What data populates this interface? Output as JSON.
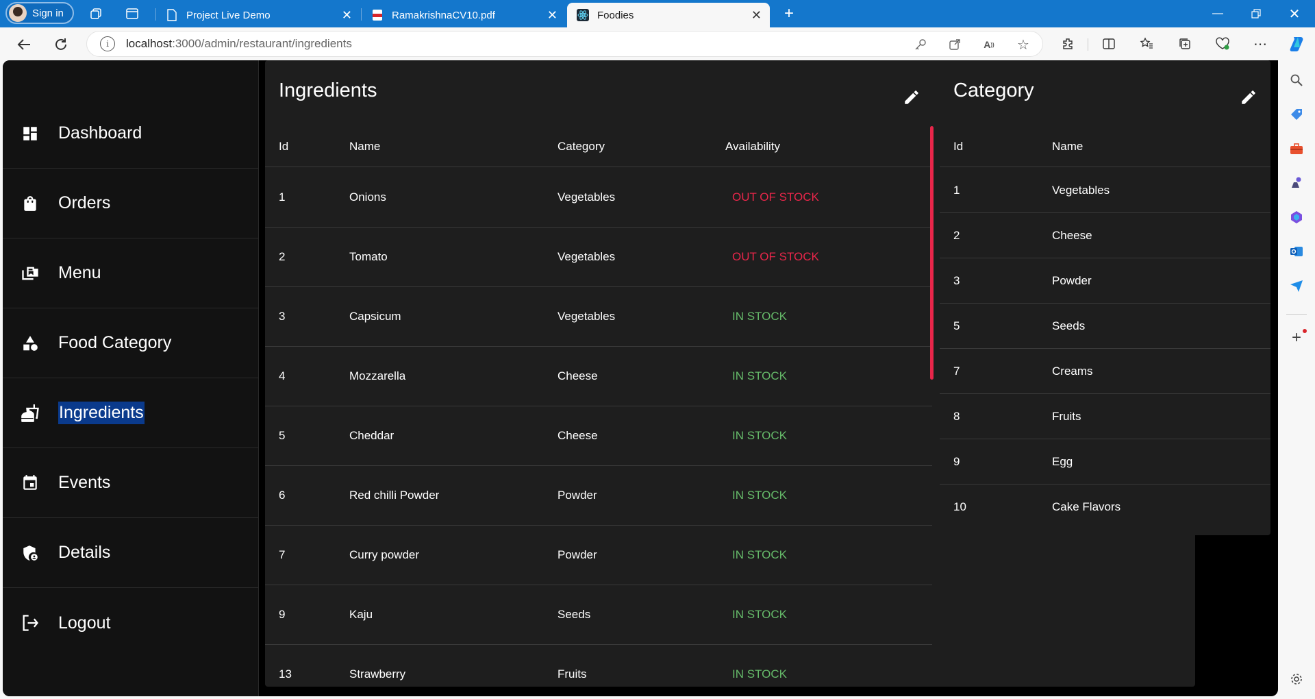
{
  "browser": {
    "sign_in_label": "Sign in",
    "tabs": [
      {
        "title": "Project Live Demo",
        "icon": "page-icon"
      },
      {
        "title": "RamakrishnaCV10.pdf",
        "icon": "pdf-icon"
      },
      {
        "title": "Foodies",
        "icon": "react-icon"
      }
    ],
    "url_host": "localhost",
    "url_path": ":3000/admin/restaurant/ingredients"
  },
  "sidebar": {
    "items": [
      {
        "label": "Dashboard",
        "icon": "dashboard-icon"
      },
      {
        "label": "Orders",
        "icon": "shopping-bag-icon"
      },
      {
        "label": "Menu",
        "icon": "menu-book-icon"
      },
      {
        "label": "Food Category",
        "icon": "category-icon"
      },
      {
        "label": "Ingredients",
        "icon": "fastfood-icon"
      },
      {
        "label": "Events",
        "icon": "calendar-icon"
      },
      {
        "label": "Details",
        "icon": "admin-panel-icon"
      },
      {
        "label": "Logout",
        "icon": "logout-icon"
      }
    ],
    "selected": "Ingredients"
  },
  "ingredients": {
    "title": "Ingredients",
    "columns": [
      "Id",
      "Name",
      "Category",
      "Availability"
    ],
    "rows": [
      {
        "id": "1",
        "name": "Onions",
        "category": "Vegetables",
        "availability": "OUT OF STOCK"
      },
      {
        "id": "2",
        "name": "Tomato",
        "category": "Vegetables",
        "availability": "OUT OF STOCK"
      },
      {
        "id": "3",
        "name": "Capsicum",
        "category": "Vegetables",
        "availability": "IN STOCK"
      },
      {
        "id": "4",
        "name": "Mozzarella",
        "category": "Cheese",
        "availability": "IN STOCK"
      },
      {
        "id": "5",
        "name": "Cheddar",
        "category": "Cheese",
        "availability": "IN STOCK"
      },
      {
        "id": "6",
        "name": "Red chilli Powder",
        "category": "Powder",
        "availability": "IN STOCK"
      },
      {
        "id": "7",
        "name": "Curry powder",
        "category": "Powder",
        "availability": "IN STOCK"
      },
      {
        "id": "9",
        "name": "Kaju",
        "category": "Seeds",
        "availability": "IN STOCK"
      },
      {
        "id": "13",
        "name": "Strawberry",
        "category": "Fruits",
        "availability": "IN STOCK"
      }
    ]
  },
  "category": {
    "title": "Category",
    "columns": [
      "Id",
      "Name"
    ],
    "rows": [
      {
        "id": "1",
        "name": "Vegetables"
      },
      {
        "id": "2",
        "name": "Cheese"
      },
      {
        "id": "3",
        "name": "Powder"
      },
      {
        "id": "5",
        "name": "Seeds"
      },
      {
        "id": "7",
        "name": "Creams"
      },
      {
        "id": "8",
        "name": "Fruits"
      },
      {
        "id": "9",
        "name": "Egg"
      },
      {
        "id": "10",
        "name": "Cake Flavors"
      }
    ]
  },
  "colors": {
    "out_of_stock": "#e8264a",
    "in_stock": "#66bb6a",
    "browser_chrome": "#1477cc",
    "selection": "#0a3a8c"
  }
}
